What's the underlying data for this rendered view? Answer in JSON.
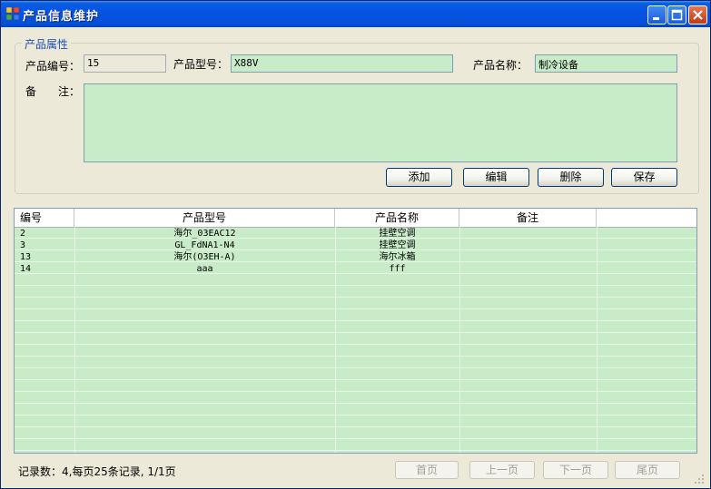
{
  "window": {
    "title": "产品信息维护"
  },
  "group": {
    "title": "产品属性"
  },
  "form": {
    "code_label": "产品编号：",
    "code_value": "15",
    "model_label": "产品型号：",
    "model_value": "X88V",
    "name_label": "产品名称：",
    "name_value": "制冷设备",
    "remark_label": "备　　注：",
    "remark_value": ""
  },
  "buttons": {
    "add": "添加",
    "edit": "编辑",
    "delete": "删除",
    "save": "保存"
  },
  "grid": {
    "headers": [
      "编号",
      "产品型号",
      "产品名称",
      "备注"
    ],
    "rows": [
      [
        "2",
        "海尔_03EAC12",
        "挂壁空调",
        ""
      ],
      [
        "3",
        "GL_FdNA1-N4",
        "挂壁空调",
        ""
      ],
      [
        "13",
        "海尔(O3EH-A)",
        "海尔冰箱",
        ""
      ],
      [
        "14",
        "aaa",
        "fff",
        ""
      ]
    ]
  },
  "status": {
    "text": "记录数：4,每页25条记录, 1/1页"
  },
  "pager": {
    "first": "首页",
    "prev": "上一页",
    "next": "下一页",
    "last": "尾页"
  },
  "colors": {
    "titlebar": "#0553e4",
    "field_bg": "#c8ebc8",
    "window_bg": "#ece9d8"
  }
}
